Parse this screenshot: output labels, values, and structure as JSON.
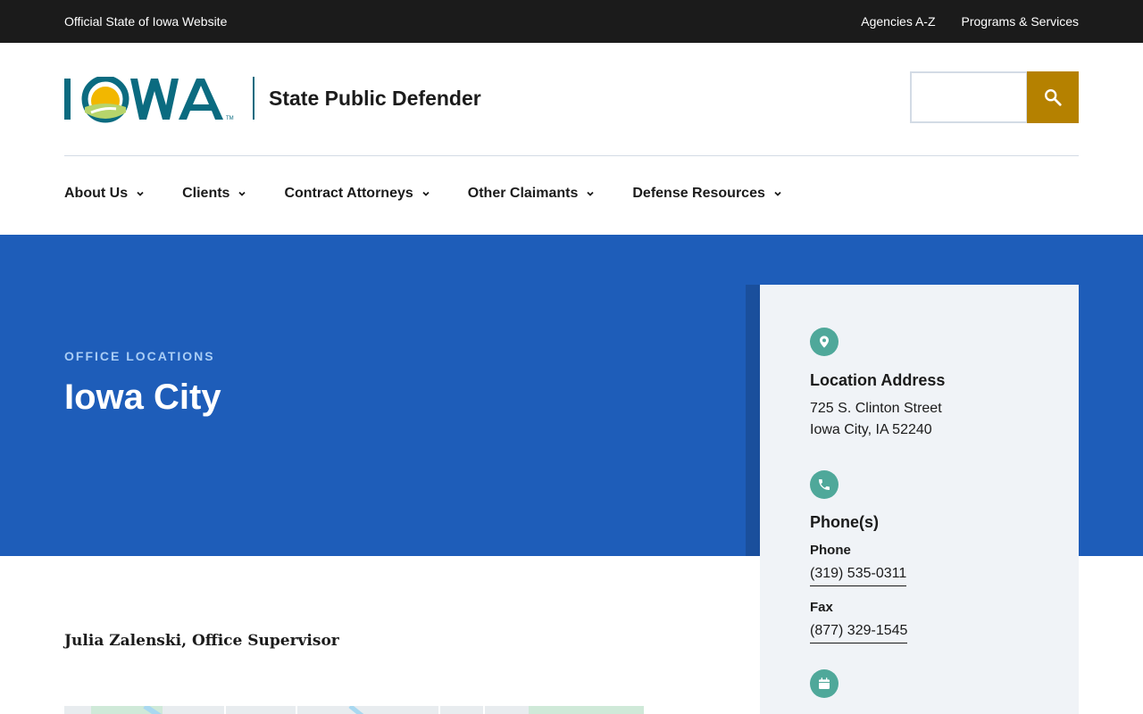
{
  "topbar": {
    "official": "Official State of Iowa Website",
    "links": [
      "Agencies A-Z",
      "Programs & Services"
    ]
  },
  "header": {
    "logo_text": "IOWA",
    "agency_name": "State Public Defender",
    "search": {
      "placeholder": "",
      "button_icon": "search-icon"
    }
  },
  "nav": {
    "items": [
      "About Us",
      "Clients",
      "Contract Attorneys",
      "Other Claimants",
      "Defense Resources"
    ]
  },
  "hero": {
    "eyebrow": "OFFICE LOCATIONS",
    "title": "Iowa City"
  },
  "contact": {
    "address_heading": "Location Address",
    "address_line1": "725 S. Clinton Street",
    "address_line2": "Iowa City, IA 52240",
    "phones_heading": "Phone(s)",
    "phone_label": "Phone",
    "phone_number": "(319) 535-0311",
    "fax_label": "Fax",
    "fax_number": "(877) 329-1545"
  },
  "main": {
    "supervisor": "Julia Zalenski, Office Supervisor"
  },
  "colors": {
    "topbar": "#1b1b1b",
    "hero": "#1e5db9",
    "search_button": "#b58100",
    "icon_teal": "#4fa89a",
    "panel": "#f0f3f7"
  }
}
